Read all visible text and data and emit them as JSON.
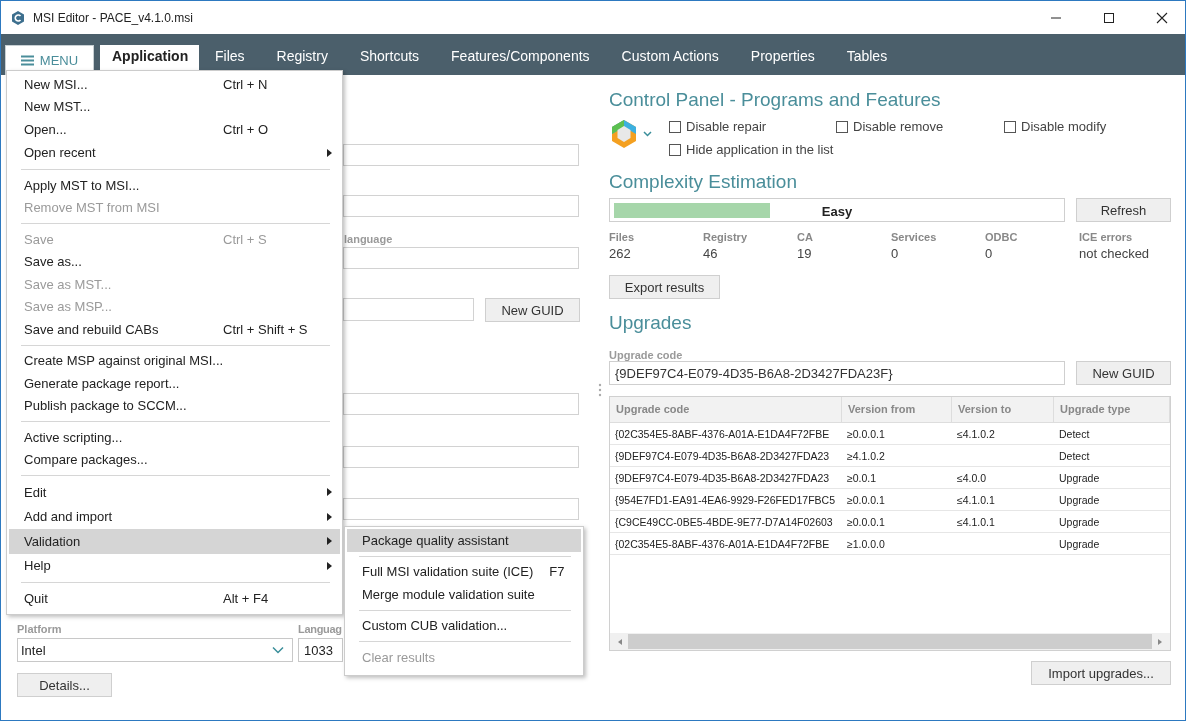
{
  "window": {
    "title": "MSI Editor - PACE_v4.1.0.msi"
  },
  "menu_button": {
    "label": "MENU"
  },
  "tabs": [
    {
      "label": "Application",
      "selected": true
    },
    {
      "label": "Files",
      "selected": false
    },
    {
      "label": "Registry",
      "selected": false
    },
    {
      "label": "Shortcuts",
      "selected": false
    },
    {
      "label": "Features/Components",
      "selected": false
    },
    {
      "label": "Custom Actions",
      "selected": false
    },
    {
      "label": "Properties",
      "selected": false
    },
    {
      "label": "Tables",
      "selected": false
    }
  ],
  "app_menu": {
    "items": [
      {
        "kind": "item",
        "label": "New MSI...",
        "shortcut": "Ctrl + N",
        "disabled": false,
        "submenu": false,
        "selected": false
      },
      {
        "kind": "item",
        "label": "New MST...",
        "disabled": false,
        "submenu": false,
        "selected": false
      },
      {
        "kind": "item",
        "label": "Open...",
        "shortcut": "Ctrl + O",
        "disabled": false,
        "submenu": false,
        "selected": false
      },
      {
        "kind": "item",
        "label": "Open recent",
        "disabled": false,
        "submenu": true,
        "selected": false
      },
      {
        "kind": "separator"
      },
      {
        "kind": "item",
        "label": "Apply MST to MSI...",
        "disabled": false,
        "submenu": false,
        "selected": false
      },
      {
        "kind": "item",
        "label": "Remove MST from MSI",
        "disabled": true,
        "submenu": false,
        "selected": false
      },
      {
        "kind": "separator"
      },
      {
        "kind": "item",
        "label": "Save",
        "shortcut": "Ctrl + S",
        "disabled": true,
        "submenu": false,
        "selected": false
      },
      {
        "kind": "item",
        "label": "Save as...",
        "disabled": false,
        "submenu": false,
        "selected": false
      },
      {
        "kind": "item",
        "label": "Save as MST...",
        "disabled": true,
        "submenu": false,
        "selected": false
      },
      {
        "kind": "item",
        "label": "Save as MSP...",
        "disabled": true,
        "submenu": false,
        "selected": false
      },
      {
        "kind": "item",
        "label": "Save and rebuild CABs",
        "shortcut": "Ctrl + Shift + S",
        "disabled": false,
        "submenu": false,
        "selected": false
      },
      {
        "kind": "separator"
      },
      {
        "kind": "item",
        "label": "Create MSP against original MSI...",
        "disabled": false,
        "submenu": false,
        "selected": false
      },
      {
        "kind": "item",
        "label": "Generate package report...",
        "disabled": false,
        "submenu": false,
        "selected": false
      },
      {
        "kind": "item",
        "label": "Publish package to SCCM...",
        "disabled": false,
        "submenu": false,
        "selected": false
      },
      {
        "kind": "separator"
      },
      {
        "kind": "item",
        "label": "Active scripting...",
        "disabled": false,
        "submenu": false,
        "selected": false
      },
      {
        "kind": "item",
        "label": "Compare packages...",
        "disabled": false,
        "submenu": false,
        "selected": false
      },
      {
        "kind": "separator"
      },
      {
        "kind": "item",
        "label": "Edit",
        "disabled": false,
        "submenu": true,
        "selected": false
      },
      {
        "kind": "item",
        "label": "Add and import",
        "disabled": false,
        "submenu": true,
        "selected": false
      },
      {
        "kind": "item",
        "label": "Validation",
        "disabled": false,
        "submenu": true,
        "selected": true
      },
      {
        "kind": "item",
        "label": "Help",
        "disabled": false,
        "submenu": true,
        "selected": false
      },
      {
        "kind": "separator"
      },
      {
        "kind": "item",
        "label": "Quit",
        "shortcut": "Alt + F4",
        "disabled": false,
        "submenu": false,
        "selected": false
      }
    ]
  },
  "validation_submenu": {
    "items": [
      {
        "kind": "item",
        "label": "Package quality assistant",
        "disabled": false,
        "selected": true
      },
      {
        "kind": "separator"
      },
      {
        "kind": "item",
        "label": "Full MSI validation suite (ICE)",
        "shortcut": "F7",
        "disabled": false,
        "selected": false
      },
      {
        "kind": "item",
        "label": "Merge module validation suite",
        "disabled": false,
        "selected": false
      },
      {
        "kind": "separator"
      },
      {
        "kind": "item",
        "label": "Custom CUB validation...",
        "disabled": false,
        "selected": false
      },
      {
        "kind": "separator"
      },
      {
        "kind": "item",
        "label": "Clear results",
        "disabled": true,
        "selected": false
      }
    ]
  },
  "application_form": {
    "language_label": "language",
    "new_guid_button": "New GUID",
    "platform": {
      "label": "Platform",
      "value": "Intel"
    },
    "language": {
      "label": "Languag",
      "value": "1033"
    },
    "details_button": "Details..."
  },
  "control_panel": {
    "title": "Control Panel - Programs and Features",
    "checkboxes": [
      {
        "label": "Disable repair",
        "checked": false
      },
      {
        "label": "Disable remove",
        "checked": false
      },
      {
        "label": "Disable modify",
        "checked": false
      },
      {
        "label": "Hide application in the list",
        "checked": false
      }
    ]
  },
  "complexity": {
    "title": "Complexity Estimation",
    "level": 0.35,
    "rating": "Easy",
    "refresh_button": "Refresh",
    "stats": [
      {
        "label": "Files",
        "value": "262"
      },
      {
        "label": "Registry",
        "value": "46"
      },
      {
        "label": "CA",
        "value": "19"
      },
      {
        "label": "Services",
        "value": "0"
      },
      {
        "label": "ODBC",
        "value": "0"
      },
      {
        "label": "ICE errors",
        "value": "not checked"
      }
    ],
    "export_button": "Export results"
  },
  "upgrades": {
    "title": "Upgrades",
    "code_label": "Upgrade code",
    "code_value": "{9DEF97C4-E079-4D35-B6A8-2D3427FDA23F}",
    "new_guid_button": "New GUID",
    "table": {
      "columns": [
        "Upgrade code",
        "Version from",
        "Version to",
        "Upgrade type"
      ],
      "rows": [
        [
          "{02C354E5-8ABF-4376-A01A-E1DA4F72FBE",
          "≥0.0.0.1",
          "≤4.1.0.2",
          "Detect"
        ],
        [
          "{9DEF97C4-E079-4D35-B6A8-2D3427FDA23",
          "≥4.1.0.2",
          "",
          "Detect"
        ],
        [
          "{9DEF97C4-E079-4D35-B6A8-2D3427FDA23",
          "≥0.0.1",
          "≤4.0.0",
          "Upgrade"
        ],
        [
          "{954E7FD1-EA91-4EA6-9929-F26FED17FBC5",
          "≥0.0.0.1",
          "≤4.1.0.1",
          "Upgrade"
        ],
        [
          "{C9CE49CC-0BE5-4BDE-9E77-D7A14F02603",
          "≥0.0.0.1",
          "≤4.1.0.1",
          "Upgrade"
        ],
        [
          "{02C354E5-8ABF-4376-A01A-E1DA4F72FBE",
          "≥1.0.0.0",
          "",
          "Upgrade"
        ]
      ]
    },
    "import_button": "Import upgrades..."
  }
}
